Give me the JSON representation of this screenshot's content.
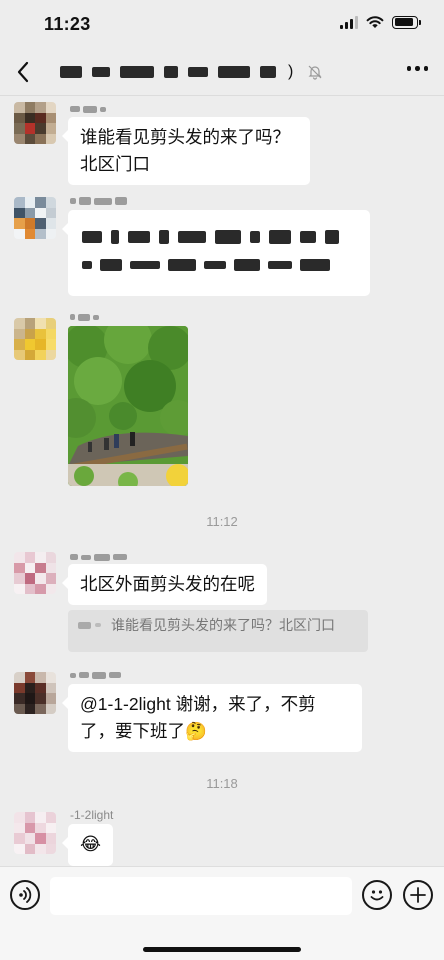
{
  "status_bar": {
    "time": "11:23"
  },
  "nav": {
    "title_suffix": ")"
  },
  "messages": [
    {
      "text": "谁能看见剪头发的来了吗？北区门口"
    },
    {
      "text": "北区外面剪头发的在呢",
      "quote": "谁能看见剪头发的来了吗？北区门口"
    },
    {
      "text": "@1-1-2light 谢谢，来了，不剪了，要下班了",
      "emoji": "🤔"
    },
    {
      "sender": "-1-2light",
      "emoji": "😂"
    }
  ],
  "timestamps": [
    "11:12",
    "11:18"
  ],
  "input": {
    "placeholder": ""
  },
  "icons": {
    "back": "back-chevron-icon",
    "mute": "mute-bell-icon",
    "more": "more-icon",
    "voice": "voice-icon",
    "emoji": "emoji-icon",
    "plus": "plus-icon"
  }
}
